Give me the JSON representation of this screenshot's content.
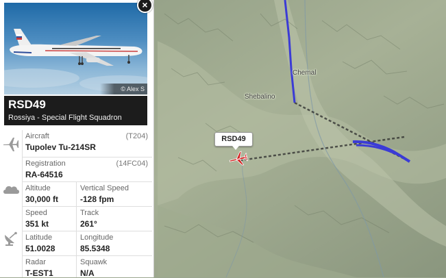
{
  "map": {
    "places": {
      "chemal": "Chemal",
      "shebalino": "Shebalino"
    },
    "callsign_bubble": "RSD49",
    "colors": {
      "track": "#3b3bd6",
      "estimated_track": "#2b2b2b",
      "marker": "#d42020"
    },
    "icons": {
      "marker": "airplane-marker-icon"
    }
  },
  "panel": {
    "close_label": "×",
    "photo_credit": "© Alex S",
    "callsign": "RSD49",
    "airline": "Rossiya - Special Flight Squadron",
    "icons": [
      "airplane-icon",
      "cloud-icon",
      "radar-dish-icon"
    ],
    "aircraft": {
      "label": "Aircraft",
      "value": "Tupolev Tu-214SR",
      "code": "(T204)"
    },
    "registration": {
      "label": "Registration",
      "value": "RA-64516",
      "code": "(14FC04)"
    },
    "altitude": {
      "label": "Altitude",
      "value": "30,000 ft"
    },
    "vertical_speed": {
      "label": "Vertical Speed",
      "value": "-128 fpm"
    },
    "speed": {
      "label": "Speed",
      "value": "351 kt"
    },
    "track": {
      "label": "Track",
      "value": "261°"
    },
    "latitude": {
      "label": "Latitude",
      "value": "51.0028"
    },
    "longitude": {
      "label": "Longitude",
      "value": "85.5348"
    },
    "radar": {
      "label": "Radar",
      "value": "T-EST1"
    },
    "squawk": {
      "label": "Squawk",
      "value": "N/A"
    }
  }
}
